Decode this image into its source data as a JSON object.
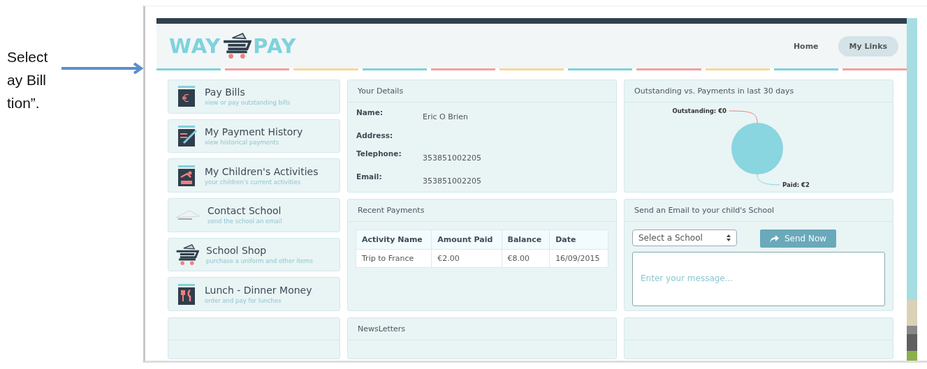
{
  "annotation": {
    "lines": [
      "Select",
      "ay Bill",
      "tion”."
    ]
  },
  "header": {
    "logo": {
      "left": "WAY",
      "right": "PAY"
    },
    "nav": [
      {
        "label": "Home",
        "selected": false
      },
      {
        "label": "My Links",
        "selected": true
      }
    ]
  },
  "menu": [
    {
      "kind": "bills",
      "title": "Pay Bills",
      "subtitle": "view or pay outstanding bills"
    },
    {
      "kind": "history",
      "title": "My Payment History",
      "subtitle": "view historical payments"
    },
    {
      "kind": "activities",
      "title": "My Children's Activities",
      "subtitle": "your children's current activities"
    },
    {
      "kind": "contact",
      "title": "Contact School",
      "subtitle": "send the school an email"
    },
    {
      "kind": "shop",
      "title": "School Shop",
      "subtitle": "purchase a uniform and other items"
    },
    {
      "kind": "lunch",
      "title": "Lunch - Dinner Money",
      "subtitle": "order and pay for lunches"
    }
  ],
  "details": {
    "title": "Your Details",
    "fields": [
      {
        "label": "Name:",
        "value": "Eric O Brien"
      },
      {
        "label": "Address:"
      },
      {
        "label": "Telephone:",
        "value": "353851002205"
      },
      {
        "label": "Email:",
        "value": "353851002205"
      }
    ]
  },
  "payments": {
    "title": "Recent Payments",
    "columns": [
      "Activity Name",
      "Amount Paid",
      "Balance",
      "Date"
    ],
    "rows": [
      [
        "Trip to France",
        "€2.00",
        "€8.00",
        "16/09/2015"
      ]
    ]
  },
  "newsletters": {
    "title": "NewsLetters"
  },
  "chart": {
    "chart_data": {
      "type": "pie",
      "title": "Outstanding vs. Payments in last 30 days",
      "values": [
        0,
        2
      ],
      "value_labels": [
        "Outstanding: €0",
        "Paid: €2"
      ]
    }
  },
  "email": {
    "title": "Send an Email to your child's School",
    "select": "Select a School",
    "button": "Send Now",
    "placeholder": "Enter your message..."
  }
}
